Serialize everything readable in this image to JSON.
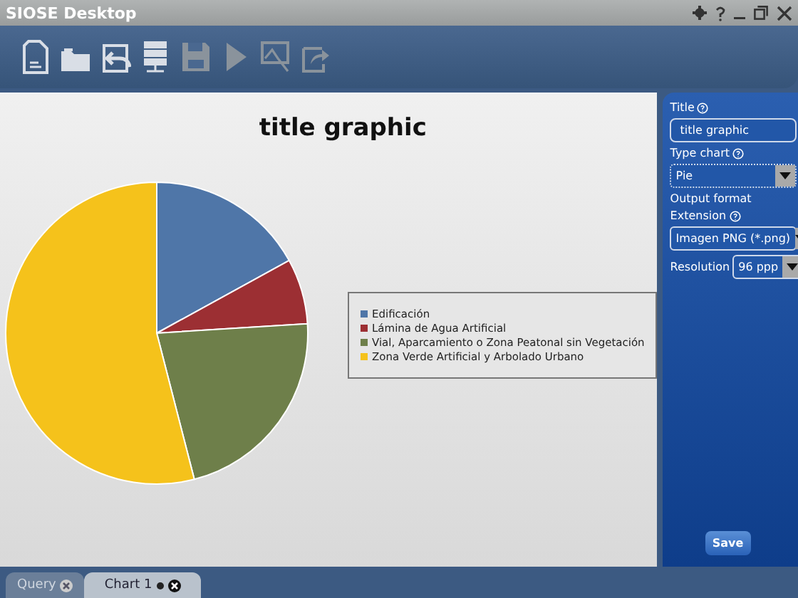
{
  "window": {
    "title": "SIOSE Desktop"
  },
  "chart": {
    "title": "title graphic",
    "legend": [
      {
        "label": "Edificación",
        "color": "#4f76a8"
      },
      {
        "label": "Lámina de Agua Artificial",
        "color": "#9c2f33"
      },
      {
        "label": "Vial, Aparcamiento o Zona Peatonal sin Vegetación",
        "color": "#6e7f4a"
      },
      {
        "label": "Zona Verde Artificial y Arbolado Urbano",
        "color": "#f5c21b"
      }
    ]
  },
  "panel": {
    "title_label": "Title",
    "title_value": "title graphic",
    "type_label": "Type chart",
    "type_value": "Pie",
    "output_label": "Output format",
    "extension_label": "Extension",
    "extension_value": "Imagen PNG (*.png)",
    "resolution_label": "Resolution",
    "resolution_value": "96 ppp",
    "save": "Save"
  },
  "tabs": [
    {
      "label": "Query",
      "selected": false,
      "modified": false
    },
    {
      "label": "Chart 1",
      "selected": true,
      "modified": true
    }
  ]
}
